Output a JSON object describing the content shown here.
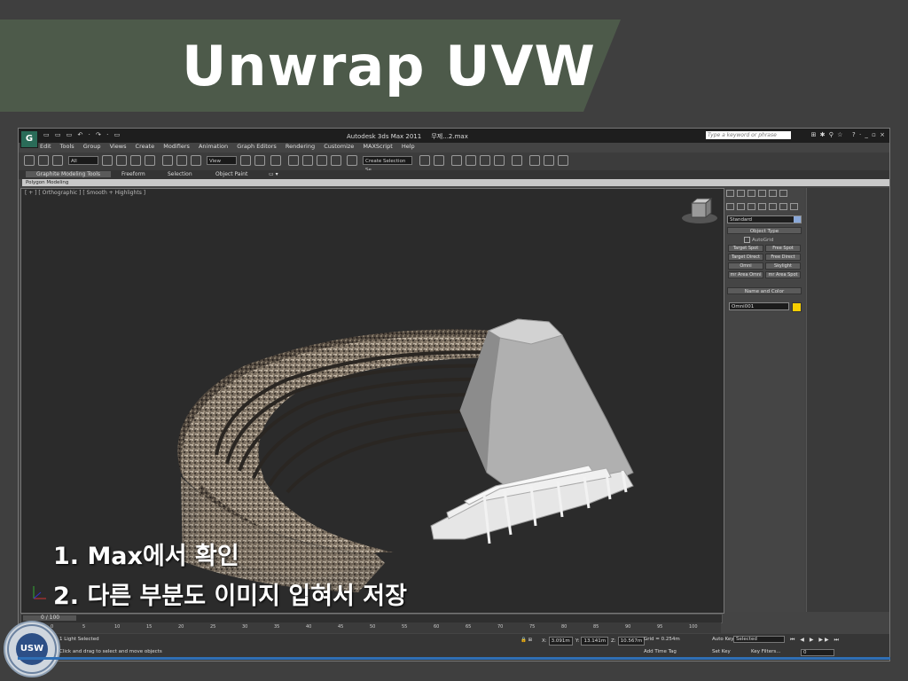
{
  "slide": {
    "title": "Unwrap UVW",
    "steps": [
      "1.  Max에서 확인",
      "2.  다른 부분도 이미지 입혀서 저장"
    ]
  },
  "app": {
    "title": "Autodesk 3ds Max 2011",
    "file_name": "무제...2.max",
    "search_placeholder": "Type a keyword or phrase",
    "menu": [
      "Edit",
      "Tools",
      "Group",
      "Views",
      "Create",
      "Modifiers",
      "Animation",
      "Graph Editors",
      "Rendering",
      "Customize",
      "MAXScript",
      "Help"
    ],
    "toolbar": {
      "filter_select": "All",
      "coord_select": "View",
      "selection_set": "Create Selection Se"
    },
    "ribbon": {
      "tabs": [
        "Graphite Modeling Tools",
        "Freeform",
        "Selection",
        "Object Paint"
      ],
      "subtab": "Polygon Modeling"
    },
    "viewport": {
      "label": "[ + ] [ Orthographic ] [ Smooth + Highlights ]"
    },
    "command_panel": {
      "category": "Standard",
      "object_type_title": "Object Type",
      "autogrid": "AutoGrid",
      "buttons": [
        "Target Spot",
        "Free Spot",
        "Target Direct",
        "Free Direct",
        "Omni",
        "Skylight",
        "mr Area Omni",
        "mr Area Spot"
      ],
      "name_color_title": "Name and Color",
      "object_name": "Omni001",
      "object_color": "#f7cf00"
    },
    "timeline": {
      "frame_label": "0 / 100",
      "ticks": [
        "0",
        "5",
        "10",
        "15",
        "20",
        "25",
        "30",
        "35",
        "40",
        "45",
        "50",
        "55",
        "60",
        "65",
        "70",
        "75",
        "80",
        "85",
        "90",
        "95",
        "100"
      ]
    },
    "status": {
      "selection_info": "1 Light Selected",
      "prompt": "Click and drag to select and move objects",
      "x_label": "X:",
      "x_value": "3.091m",
      "y_label": "Y:",
      "y_value": "13.141m",
      "z_label": "Z:",
      "z_value": "10.567m",
      "grid": "Grid = 0.254m",
      "add_time_tag": "Add Time Tag",
      "auto_key": "Auto Key",
      "set_key": "Set Key",
      "selected": "Selected",
      "key_filters": "Key Filters...",
      "current_frame": "0"
    }
  },
  "logo": {
    "text": "USW",
    "ring_text": "THE UNIVERSITY OF SUWON"
  },
  "colors": {
    "banner": "#4d5a4a",
    "background": "#3f3f3f",
    "accent_line": "#2f6fb5"
  }
}
